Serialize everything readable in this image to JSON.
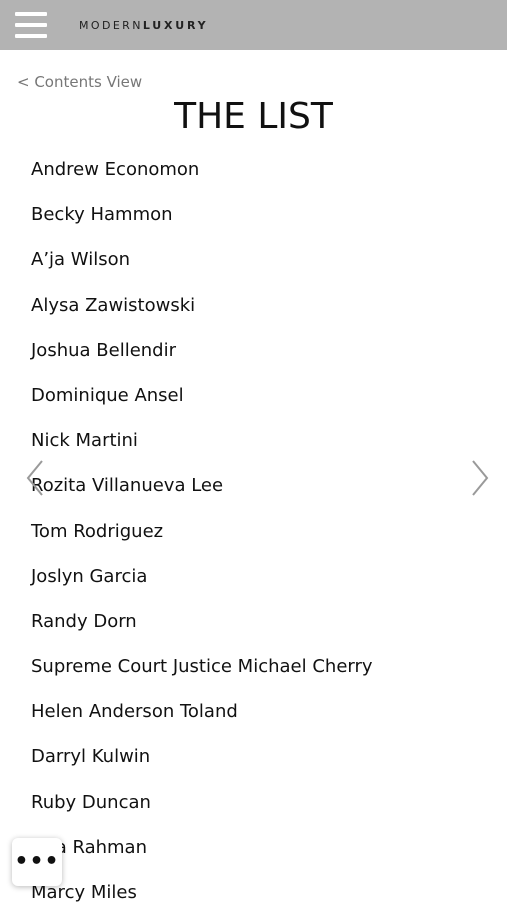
{
  "header": {
    "brand_light": "MODERN",
    "brand_bold": "LUXURY",
    "menu_icon": "hamburger-icon"
  },
  "nav": {
    "back_label": "< Contents View"
  },
  "page": {
    "title": "THE LIST"
  },
  "list": {
    "items": [
      "Andrew Economon",
      "Becky Hammon",
      "A’ja Wilson",
      "Alysa Zawistowski",
      "Joshua Bellendir",
      "Dominique Ansel",
      "Nick Martini",
      "Rozita Villanueva Lee",
      "Tom Rodriguez",
      "Joslyn Garcia",
      "Randy Dorn",
      "Supreme Court Justice Michael Cherry",
      "Helen Anderson Toland",
      "Darryl Kulwin",
      "Ruby Duncan",
      "Aria Rahman",
      "Marcy Miles"
    ]
  },
  "pager": {
    "prev_icon": "chevron-left-icon",
    "next_icon": "chevron-right-icon",
    "arrow_color": "#9a9a9a"
  },
  "fab": {
    "label": "•••",
    "icon": "more-icon"
  },
  "colors": {
    "topbar": "#b3b3b3",
    "link": "#777777",
    "text": "#111111"
  }
}
